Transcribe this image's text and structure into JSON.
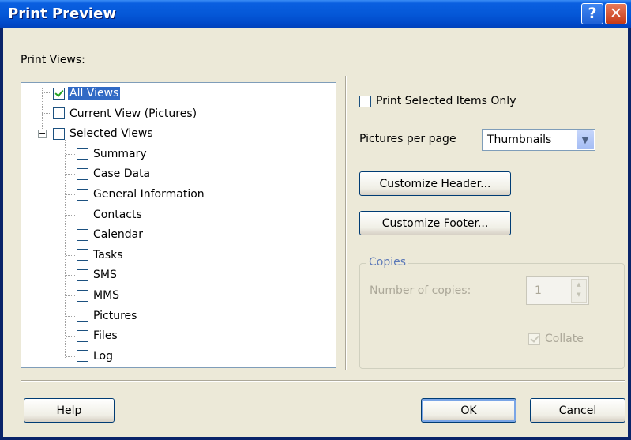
{
  "window": {
    "title": "Print Preview",
    "help_button": "?",
    "close_button": "✕"
  },
  "left": {
    "section_label": "Print Views:",
    "tree": [
      {
        "label": "All Views",
        "checked": true,
        "selected": true,
        "level": 0
      },
      {
        "label": "Current View (Pictures)",
        "checked": false,
        "level": 0
      },
      {
        "label": "Selected Views",
        "checked": false,
        "level": 0,
        "expander": "−"
      },
      {
        "label": "Summary",
        "checked": false,
        "level": 1
      },
      {
        "label": "Case Data",
        "checked": false,
        "level": 1
      },
      {
        "label": "General Information",
        "checked": false,
        "level": 1
      },
      {
        "label": "Contacts",
        "checked": false,
        "level": 1
      },
      {
        "label": "Calendar",
        "checked": false,
        "level": 1
      },
      {
        "label": "Tasks",
        "checked": false,
        "level": 1
      },
      {
        "label": "SMS",
        "checked": false,
        "level": 1
      },
      {
        "label": "MMS",
        "checked": false,
        "level": 1
      },
      {
        "label": "Pictures",
        "checked": false,
        "level": 1
      },
      {
        "label": "Files",
        "checked": false,
        "level": 1
      },
      {
        "label": "Log",
        "checked": false,
        "level": 1
      }
    ]
  },
  "right": {
    "print_selected_only": {
      "label": "Print Selected Items Only",
      "checked": false
    },
    "pictures_per_page": {
      "label": "Pictures per page",
      "value": "Thumbnails"
    },
    "customize_header": "Customize Header...",
    "customize_footer": "Customize Footer...",
    "copies": {
      "legend": "Copies",
      "number_label": "Number of copies:",
      "number_value": "1",
      "collate_label": "Collate",
      "collate_checked": true
    }
  },
  "footer": {
    "help": "Help",
    "ok": "OK",
    "cancel": "Cancel"
  },
  "colors": {
    "title_bar": "#0558d8",
    "dialog_bg": "#ece9d8",
    "selection": "#316ac5",
    "check": "#21a121"
  }
}
